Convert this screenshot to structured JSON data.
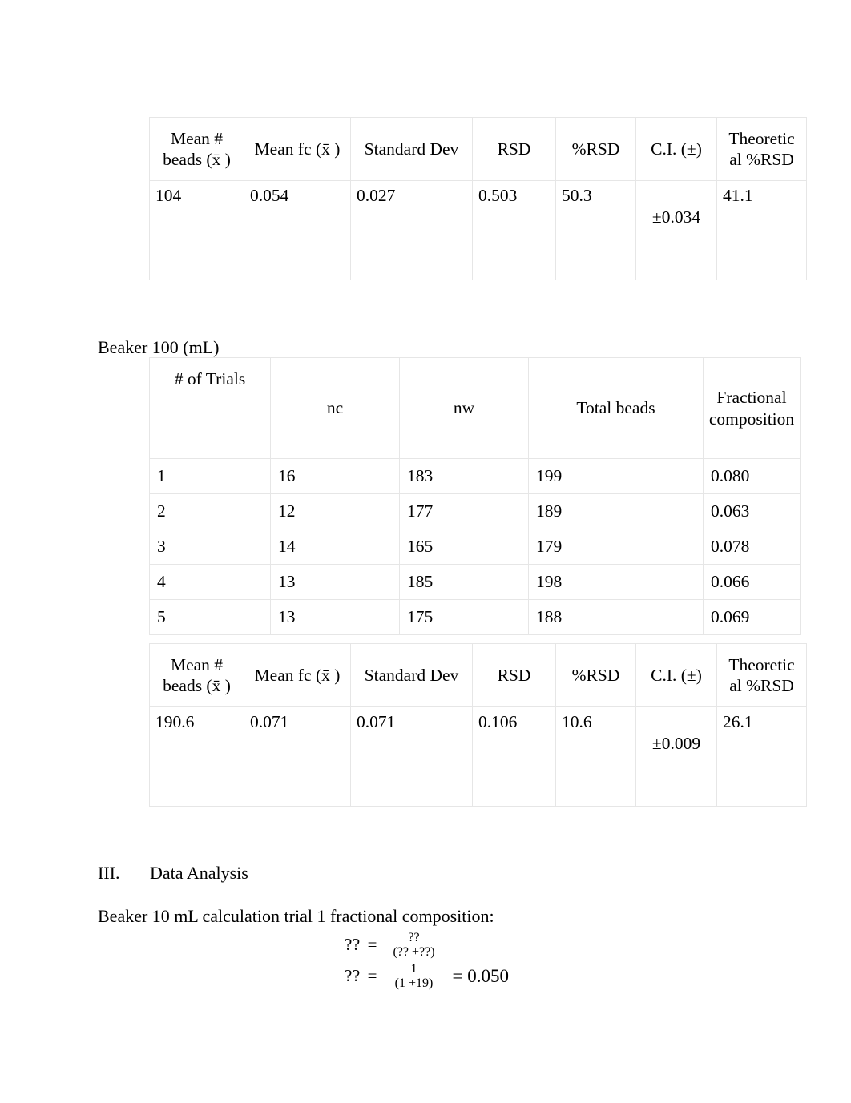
{
  "document": {
    "beaker_100_label": "Beaker 100 (mL)",
    "section": {
      "number": "III.",
      "title": "Data Analysis"
    },
    "calc_intro": "Beaker 10 mL calculation trial 1 fractional composition:"
  },
  "summary_headers": [
    "Mean # beads (x̄ )",
    "Mean fc (x̄ )",
    "Standard Dev",
    "RSD",
    "%RSD",
    "C.I. (±)",
    "Theoretical %RSD"
  ],
  "summary_header_lines": [
    [
      "Mean #",
      "beads (x̄ )"
    ],
    [
      "Mean fc (x̄ )",
      ""
    ],
    [
      "Standard Dev",
      ""
    ],
    [
      "RSD",
      ""
    ],
    [
      "%RSD",
      ""
    ],
    [
      "C.I. (±)",
      ""
    ],
    [
      "Theoretic",
      "al %RSD"
    ]
  ],
  "table_10ml_summary": {
    "mean_beads": "104",
    "mean_fc": "0.054",
    "standard_dev": "0.027",
    "rsd": "0.503",
    "pct_rsd": "50.3",
    "ci": "±0.034",
    "theoretical_pct_rsd": "41.1"
  },
  "table_100ml_trials": {
    "headers": [
      "# of Trials",
      "nc",
      "nw",
      "Total beads",
      "Fractional composition"
    ],
    "header_lines": [
      [
        "# of Trials",
        ""
      ],
      [
        "nc",
        ""
      ],
      [
        "nw",
        ""
      ],
      [
        "Total beads",
        ""
      ],
      [
        "Fractional",
        "composition"
      ]
    ],
    "rows": [
      {
        "trial": "1",
        "nc": "16",
        "nw": "183",
        "total": "199",
        "fc": "0.080"
      },
      {
        "trial": "2",
        "nc": "12",
        "nw": "177",
        "total": "189",
        "fc": "0.063"
      },
      {
        "trial": "3",
        "nc": "14",
        "nw": "165",
        "total": "179",
        "fc": "0.078"
      },
      {
        "trial": "4",
        "nc": "13",
        "nw": "185",
        "total": "198",
        "fc": "0.066"
      },
      {
        "trial": "5",
        "nc": "13",
        "nw": "175",
        "total": "188",
        "fc": "0.069"
      }
    ]
  },
  "table_100ml_summary": {
    "mean_beads": "190.6",
    "mean_fc": "0.071",
    "standard_dev": "0.071",
    "rsd": "0.106",
    "pct_rsd": "10.6",
    "ci": "±0.009",
    "theoretical_pct_rsd": "26.1"
  },
  "equations": {
    "eq1": {
      "lhs": "??",
      "equals": "=",
      "numerator": "??",
      "denominator": "(?? +??)",
      "tail": ""
    },
    "eq2": {
      "lhs": "??",
      "equals": "=",
      "numerator": "1",
      "denominator": "(1 +19)",
      "tail": "= 0.050"
    }
  }
}
